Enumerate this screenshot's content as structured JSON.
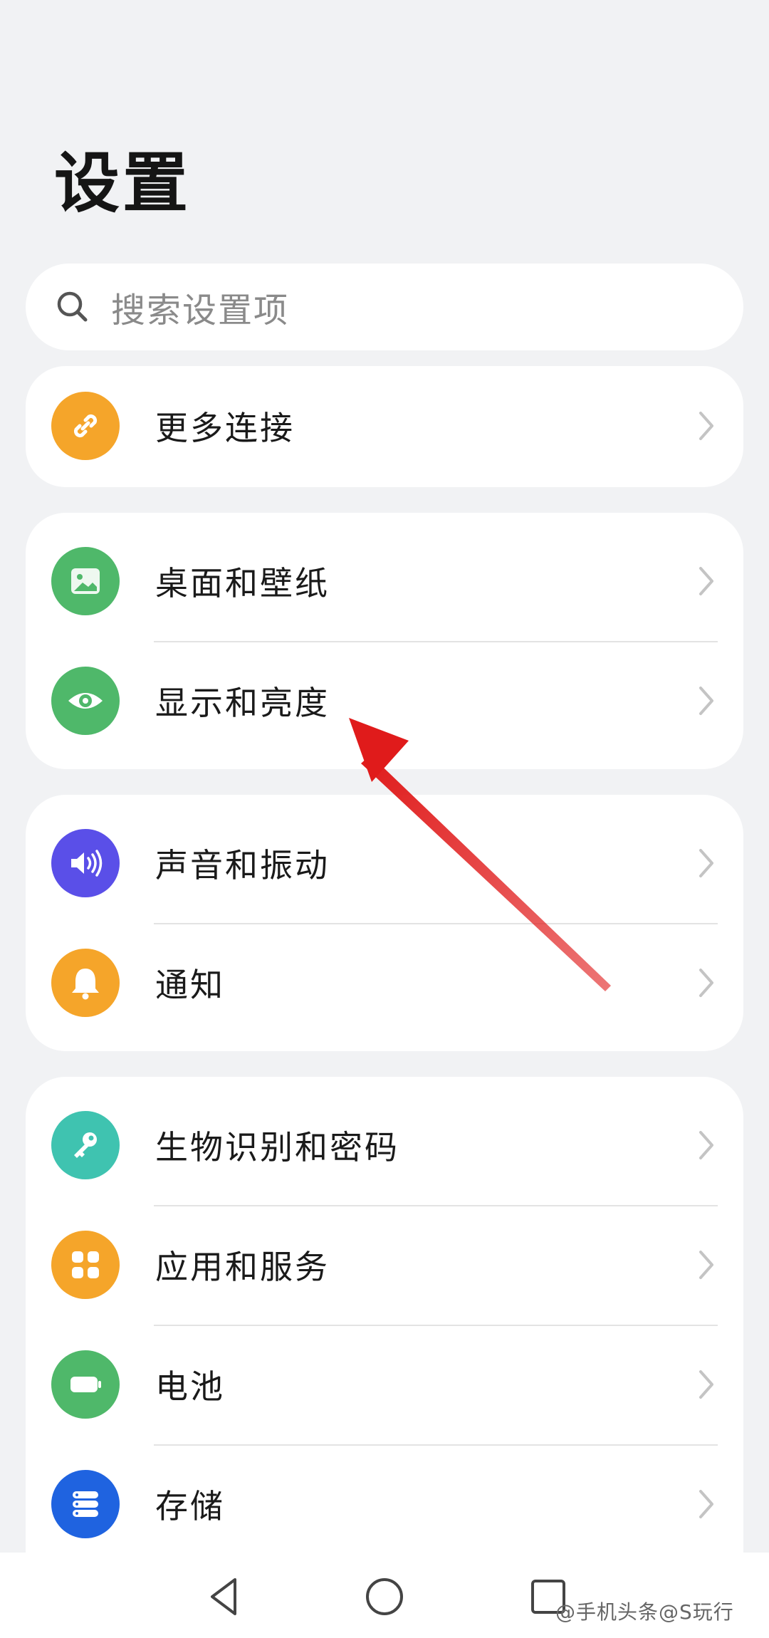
{
  "header": {
    "title": "设置"
  },
  "search": {
    "placeholder": "搜索设置项"
  },
  "groups": [
    {
      "items": [
        {
          "label": "更多连接",
          "icon": "link-icon",
          "color": "#f5a52a"
        }
      ]
    },
    {
      "items": [
        {
          "label": "桌面和壁纸",
          "icon": "image-icon",
          "color": "#4fb86a"
        },
        {
          "label": "显示和亮度",
          "icon": "eye-icon",
          "color": "#4fb86a"
        }
      ]
    },
    {
      "items": [
        {
          "label": "声音和振动",
          "icon": "speaker-icon",
          "color": "#5a4fe8"
        },
        {
          "label": "通知",
          "icon": "bell-icon",
          "color": "#f5a52a"
        }
      ]
    },
    {
      "items": [
        {
          "label": "生物识别和密码",
          "icon": "key-icon",
          "color": "#3fc3b0"
        },
        {
          "label": "应用和服务",
          "icon": "apps-grid-icon",
          "color": "#f5a52a"
        },
        {
          "label": "电池",
          "icon": "battery-icon",
          "color": "#4fb86a"
        },
        {
          "label": "存储",
          "icon": "storage-icon",
          "color": "#1f63e0"
        }
      ]
    }
  ],
  "navbar": {
    "buttons": [
      "back-icon",
      "home-icon",
      "recents-icon"
    ]
  },
  "watermark": {
    "text": "@手机头条@S玩行"
  },
  "annotation": {
    "color": "#e01b1b"
  }
}
